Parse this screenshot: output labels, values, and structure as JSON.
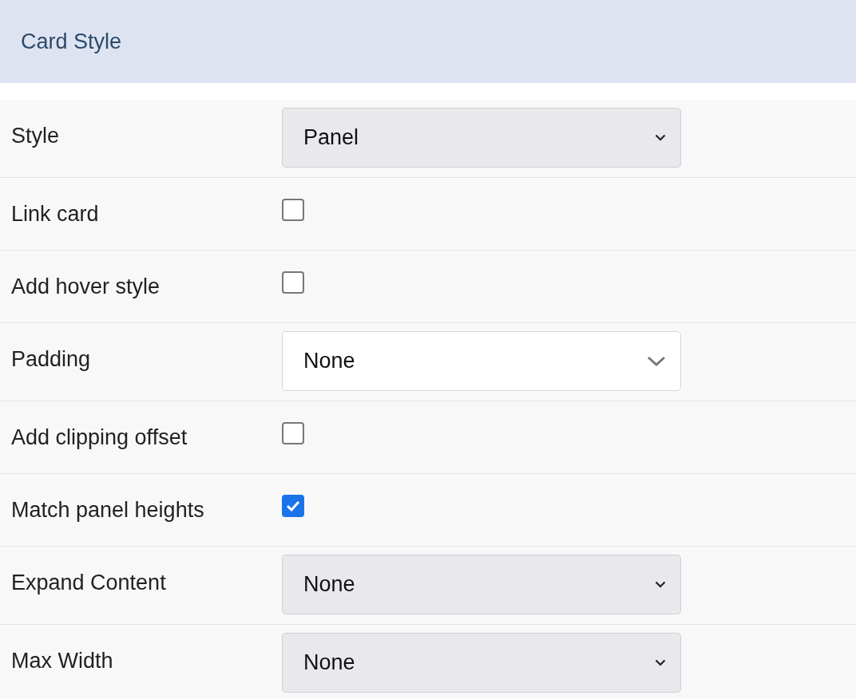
{
  "header": {
    "title": "Card Style"
  },
  "rows": [
    {
      "label": "Style",
      "kind": "select",
      "value": "Panel"
    },
    {
      "label": "Link card",
      "kind": "checkbox",
      "checked": false
    },
    {
      "label": "Add hover style",
      "kind": "checkbox",
      "checked": false
    },
    {
      "label": "Padding",
      "kind": "dropdown",
      "value": "None"
    },
    {
      "label": "Add clipping offset",
      "kind": "checkbox",
      "checked": false
    },
    {
      "label": "Match panel heights",
      "kind": "checkbox",
      "checked": true
    },
    {
      "label": "Expand Content",
      "kind": "select",
      "value": "None"
    },
    {
      "label": "Max Width",
      "kind": "select",
      "value": "None"
    }
  ]
}
